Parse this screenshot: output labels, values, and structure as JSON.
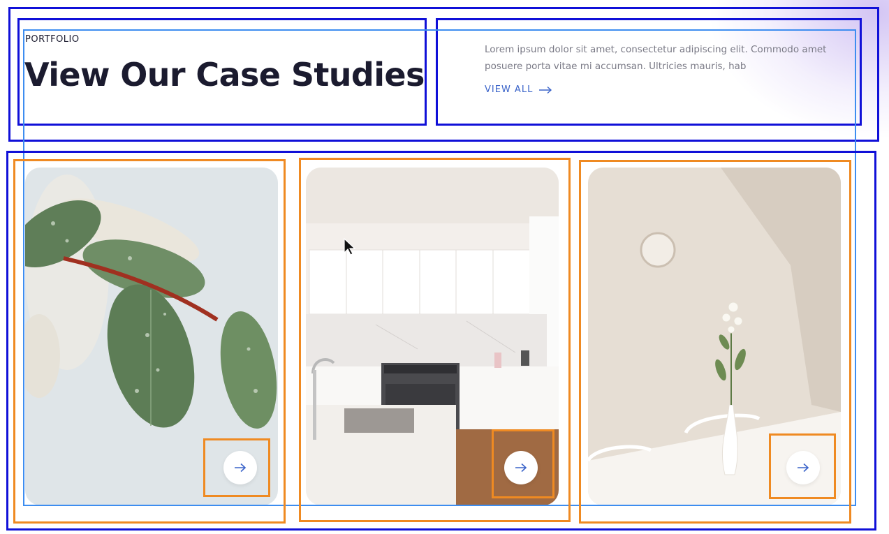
{
  "header": {
    "eyebrow": "PORTFOLIO",
    "title": "View Our Case Studies",
    "description": "Lorem ipsum dolor sit amet, consectetur adipiscing elit. Commodo amet posuere porta vitae mi accumsan. Ultricies mauris, hab",
    "view_all_label": "VIEW ALL",
    "view_all_icon": "arrow-right-icon"
  },
  "cards": [
    {
      "image": "leaves-with-water-drops",
      "button_icon": "arrow-right-icon"
    },
    {
      "image": "white-kitchen-interior",
      "button_icon": "arrow-right-icon"
    },
    {
      "image": "vase-with-flowers-on-table",
      "button_icon": "arrow-right-icon"
    }
  ],
  "colors": {
    "heading": "#1b1b2f",
    "body_text": "#7a7a86",
    "accent": "#3a63c9",
    "annotation_blue": "#1010d8",
    "annotation_orange": "#ef8a22"
  }
}
